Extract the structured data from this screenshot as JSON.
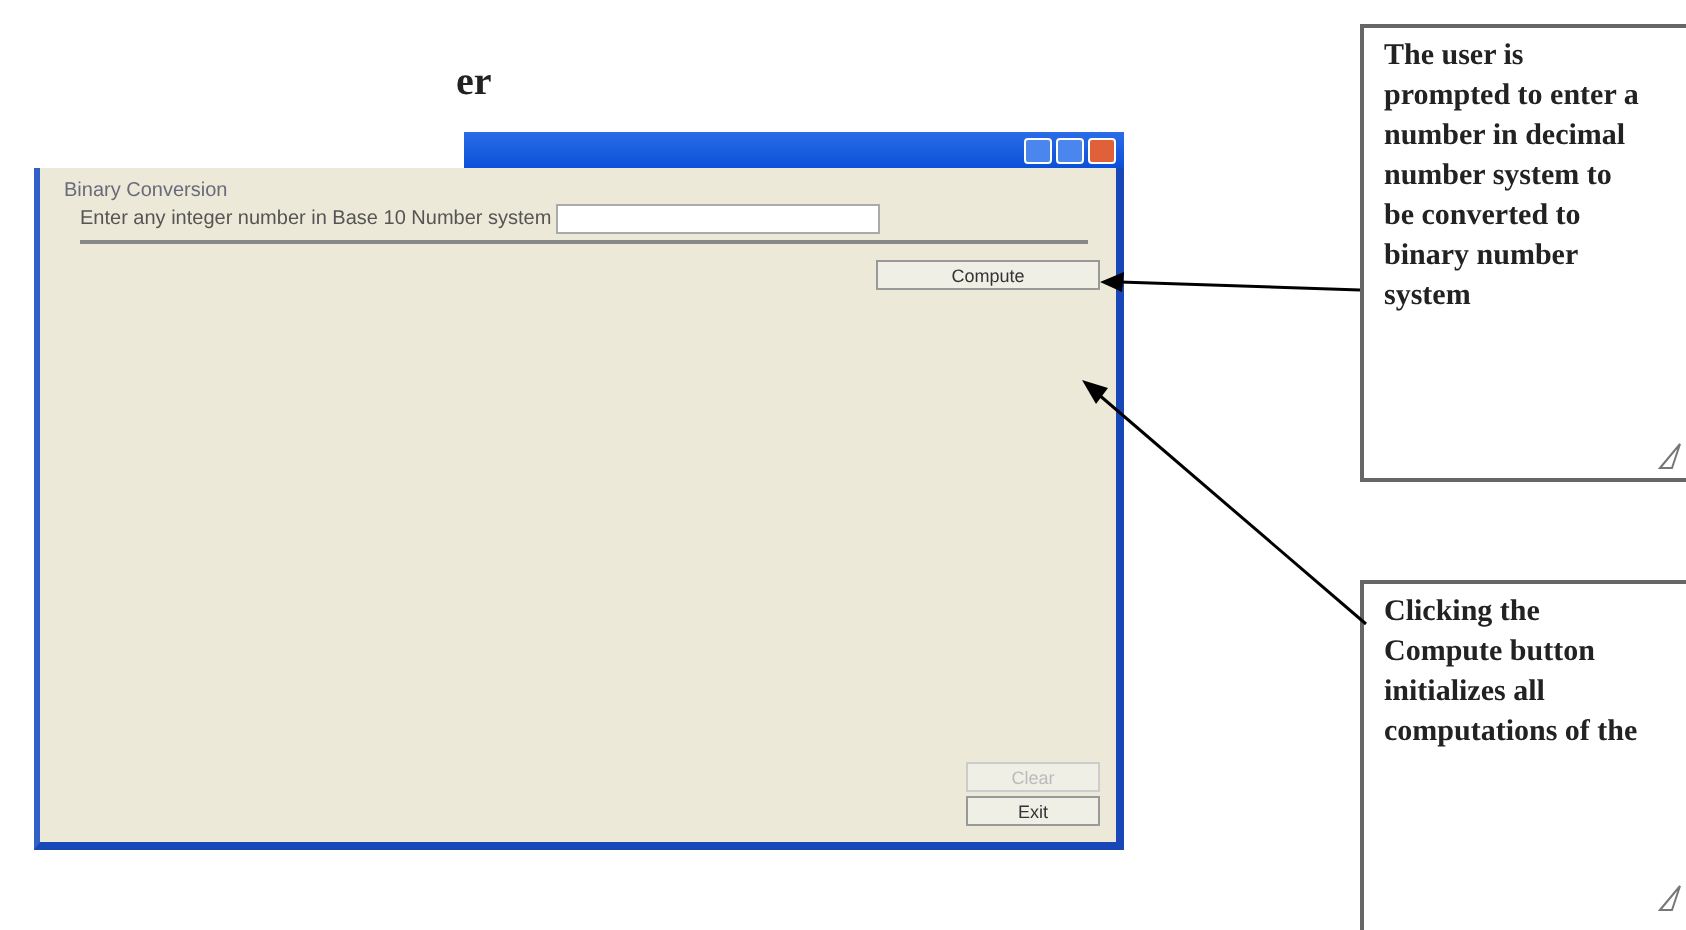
{
  "heading": "er",
  "window": {
    "group_title": "Binary Conversion",
    "prompt": "Enter any integer number in Base 10 Number system",
    "top_buttons": [
      {
        "label": "Compute",
        "disabled": false
      }
    ],
    "bottom_buttons": [
      {
        "label": "Clear",
        "disabled": true
      },
      {
        "label": "Exit",
        "disabled": false
      }
    ]
  },
  "callouts": [
    "The user is prompted to enter a number in decimal number system to be converted to binary number system",
    "Clicking the Compute button initializes all computations of the"
  ]
}
